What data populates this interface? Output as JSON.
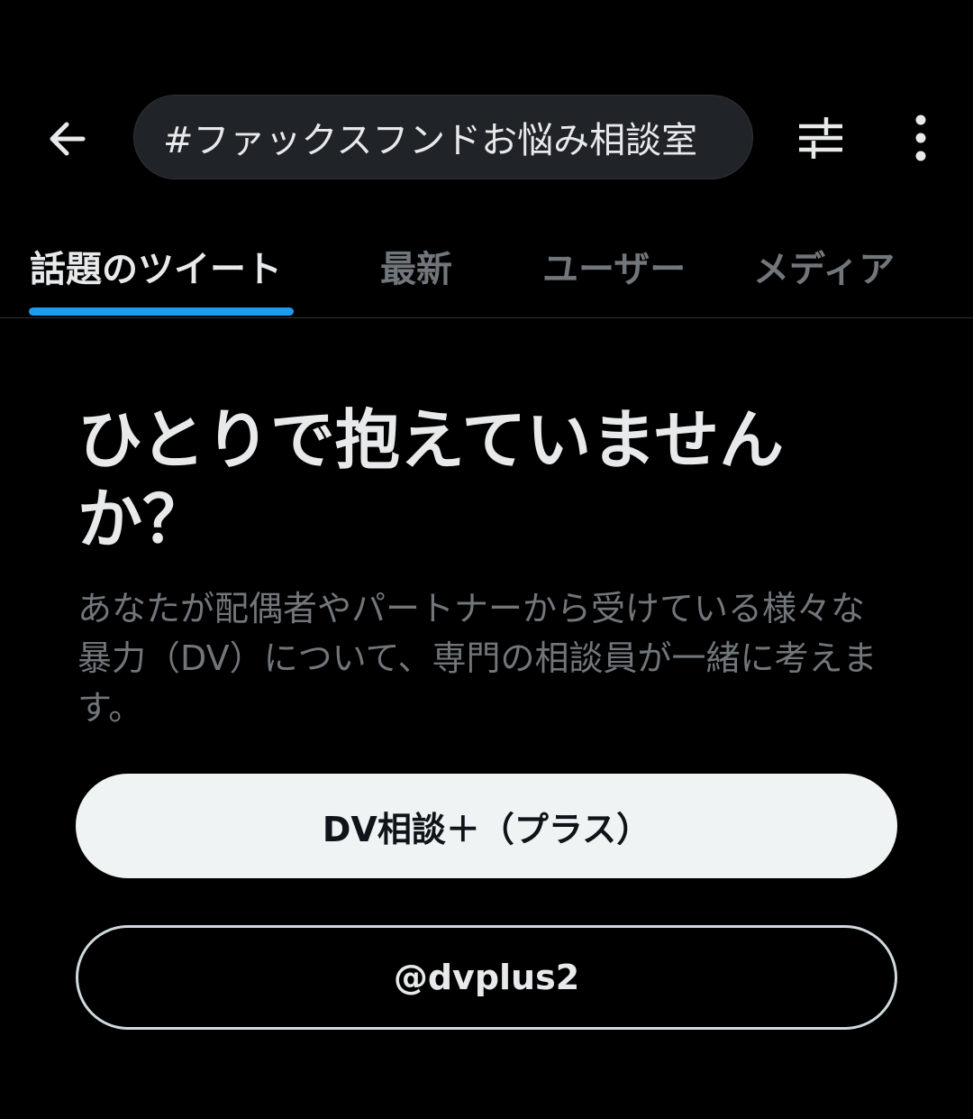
{
  "header": {
    "back_icon": "arrow-left-icon",
    "search_query": "#ファックスフンドお悩み相談室",
    "filter_icon": "sliders-icon",
    "more_icon": "more-vertical-icon"
  },
  "tabs": [
    {
      "label": "話題のツイート",
      "active": true
    },
    {
      "label": "最新",
      "active": false
    },
    {
      "label": "ユーザー",
      "active": false
    },
    {
      "label": "メディア",
      "active": false
    }
  ],
  "promo": {
    "headline": "ひとりで抱えていませんか？",
    "body": "あなたが配偶者やパートナーから受けている様々な暴力（DV）について、専門の相談員が一緒に考えます。",
    "primary_button": "DV相談＋（プラス）",
    "secondary_button": "@dvplus2"
  },
  "colors": {
    "background": "#000000",
    "accent": "#1d9bf0",
    "text_primary": "#e7e9ea",
    "text_secondary": "#71767b",
    "search_bg": "#202327"
  }
}
